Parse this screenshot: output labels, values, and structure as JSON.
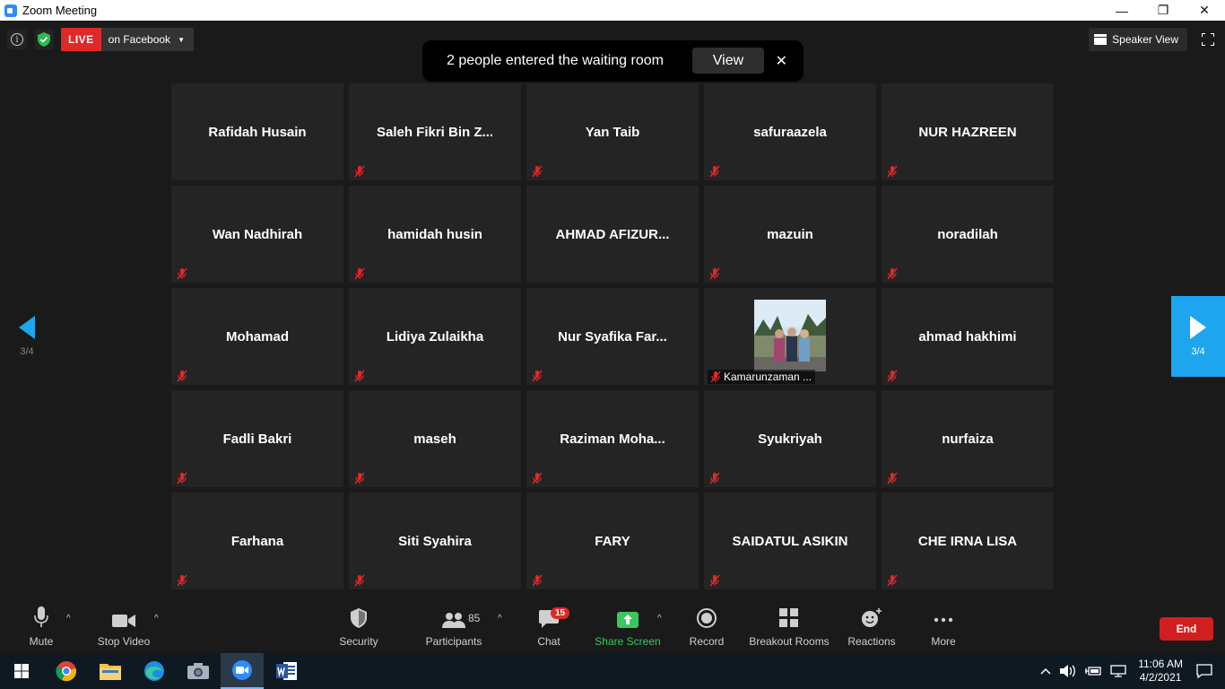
{
  "window": {
    "title": "Zoom Meeting",
    "minimize": "—",
    "restore": "❐",
    "close": "✕"
  },
  "topbar": {
    "live_label": "LIVE",
    "live_destination": "on Facebook",
    "caret": "▼",
    "speaker_view_label": "Speaker View"
  },
  "notification": {
    "message": "2 people entered the waiting room",
    "view_label": "View",
    "close": "✕"
  },
  "pagination": {
    "left_page": "3/4",
    "right_page": "3/4"
  },
  "participants": [
    "Rafidah Husain",
    "Saleh  Fikri  Bin  Z...",
    "Yan Taib",
    "safuraazela",
    "NUR HAZREEN",
    "Wan Nadhirah",
    "hamidah husin",
    "AHMAD  AFIZUR...",
    "mazuin",
    "noradilah",
    "Mohamad",
    "Lidiya Zulaikha",
    "Nur  Syafika  Far...",
    "Kamarunzaman ...",
    "ahmad hakhimi",
    "Fadli Bakri",
    "maseh",
    "Raziman  Moha...",
    "Syukriyah",
    "nurfaiza",
    "Farhana",
    "Siti Syahira",
    "FARY",
    "SAIDATUL ASIKIN",
    "CHE IRNA LISA"
  ],
  "toolbar": {
    "mute": "Mute",
    "stop_video": "Stop Video",
    "security": "Security",
    "participants": "Participants",
    "participants_count": "85",
    "chat": "Chat",
    "chat_badge": "15",
    "share_screen": "Share Screen",
    "record": "Record",
    "breakout_rooms": "Breakout Rooms",
    "reactions": "Reactions",
    "more": "More",
    "end": "End",
    "caret": "^"
  },
  "taskbar": {
    "time": "11:06 AM",
    "date": "4/2/2021"
  },
  "colors": {
    "live": "#e02828",
    "share": "#3bc75e",
    "end": "#d11f1f",
    "page_active": "#1ea5f0"
  }
}
